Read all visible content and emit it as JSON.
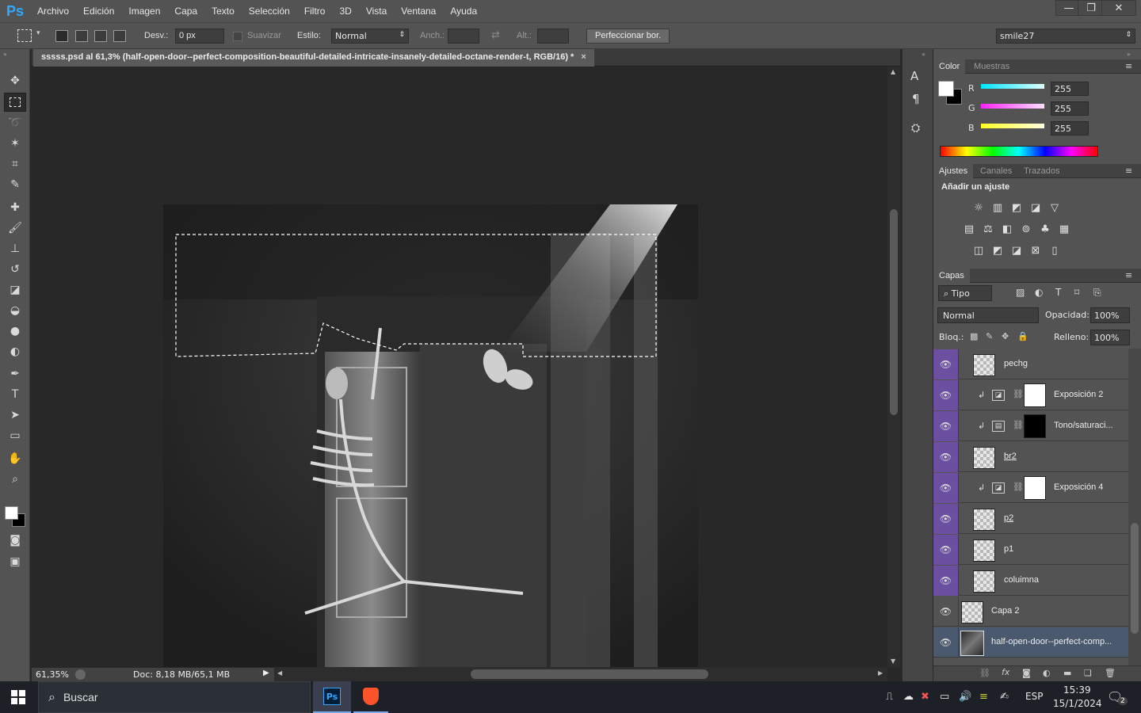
{
  "app": {
    "logo": "Ps"
  },
  "menu": [
    "Archivo",
    "Edición",
    "Imagen",
    "Capa",
    "Texto",
    "Selección",
    "Filtro",
    "3D",
    "Vista",
    "Ventana",
    "Ayuda"
  ],
  "window_controls": {
    "minimize": "—",
    "restore": "❐",
    "close": "✕"
  },
  "options": {
    "feather_label": "Desv.:",
    "feather_value": "0 px",
    "antialias_label": "Suavizar",
    "style_label": "Estilo:",
    "style_value": "Normal",
    "width_label": "Anch.:",
    "height_label": "Alt.:",
    "refine_button": "Perfeccionar bor.",
    "workspace": "smile27"
  },
  "document": {
    "tab_title": "sssss.psd al 61,3% (half-open-door--perfect-composition-beautiful-detailed-intricate-insanely-detailed-octane-render-t, RGB/16) *",
    "close": "×"
  },
  "status": {
    "zoom": "61,35%",
    "doc_info": "Doc: 8,18 MB/65,1 MB"
  },
  "color_panel": {
    "tabs": [
      "Color",
      "Muestras"
    ],
    "channels": [
      {
        "label": "R",
        "value": "255",
        "color": "#00e5ff"
      },
      {
        "label": "G",
        "value": "255",
        "color": "#ff22ff"
      },
      {
        "label": "B",
        "value": "255",
        "color": "#ffff22"
      }
    ]
  },
  "adjust_panel": {
    "tabs": [
      "Ajustes",
      "Canales",
      "Trazados"
    ],
    "title": "Añadir un ajuste"
  },
  "layers_panel": {
    "title": "Capas",
    "filter": "Tipo",
    "blend_mode": "Normal",
    "opacity_label": "Opacidad:",
    "opacity_value": "100%",
    "lock_label": "Bloq.:",
    "fill_label": "Relleno:",
    "fill_value": "100%",
    "layers": [
      {
        "name": "pechg",
        "kind": "pixel",
        "grouped": true,
        "underline": false
      },
      {
        "name": "Exposición 2",
        "kind": "adjust",
        "grouped": true,
        "mask": "white",
        "underline": false
      },
      {
        "name": "Tono/saturaci...",
        "kind": "adjust",
        "grouped": true,
        "mask": "black",
        "underline": false
      },
      {
        "name": "br2",
        "kind": "pixel",
        "grouped": true,
        "underline": true
      },
      {
        "name": "Exposición 4",
        "kind": "adjust",
        "grouped": true,
        "mask": "white",
        "underline": false
      },
      {
        "name": "p2",
        "kind": "pixel",
        "grouped": true,
        "underline": true
      },
      {
        "name": "p1",
        "kind": "pixel",
        "grouped": true,
        "underline": false
      },
      {
        "name": "coluimna",
        "kind": "pixel",
        "grouped": true,
        "underline": false
      },
      {
        "name": "Capa 2",
        "kind": "pixel",
        "grouped": false,
        "underline": false
      },
      {
        "name": "half-open-door--perfect-comp...",
        "kind": "image",
        "grouped": false,
        "underline": false,
        "selected": true
      }
    ]
  },
  "taskbar": {
    "search_placeholder": "Buscar",
    "ps_label": "Ps",
    "lang": "ESP",
    "time": "15:39",
    "date": "15/1/2024",
    "notifications": "2"
  }
}
